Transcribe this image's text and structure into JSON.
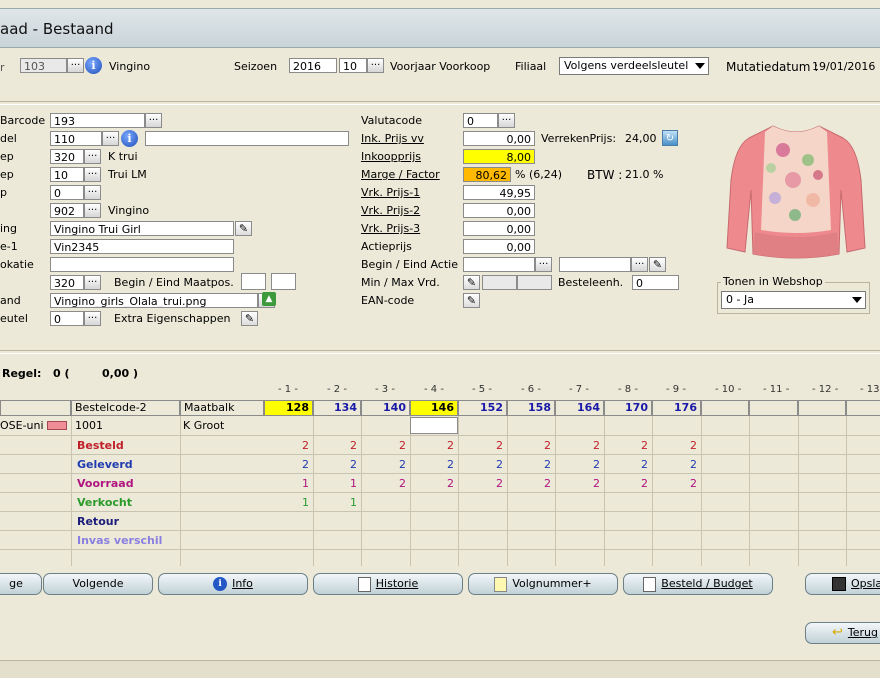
{
  "window": {
    "title": "aad - Bestaand"
  },
  "top": {
    "code_value": "103",
    "brand": "Vingino",
    "seizoen_label": "Seizoen",
    "seizoen_year": "2016",
    "seizoen_code": "10",
    "seizoen_name": "Voorjaar Voorkoop",
    "filiaal_label": "Filiaal",
    "filiaal_value": "Volgens verdeelsleutel",
    "mutatie_label": "Mutatiedatum :",
    "mutatie_value": "19/01/2016",
    "left_stub": "r"
  },
  "left": {
    "labels": [
      "Barcode",
      "del",
      "ep",
      "ep",
      "p",
      "",
      "ing",
      "e-1",
      "okatie",
      "",
      "and",
      "eutel"
    ],
    "barcode": "193",
    "artikel": "110",
    "groep1_code": "320",
    "groep1_name": "K trui",
    "groep2_code": "10",
    "groep2_name": "Trui LM",
    "f5": "0",
    "merk_code": "902",
    "merk_name": "Vingino",
    "omschrijving": "Vingino Trui Girl",
    "lev_code": "Vin2345",
    "locatie": "",
    "maat_code": "320",
    "maat_label": "Begin / Eind Maatpos.",
    "bestand": "Vingino_girls_Olala_trui.png",
    "sleutel": "0",
    "extra_label": "Extra Eigenschappen"
  },
  "mid": {
    "valutacode_label": "Valutacode",
    "valutacode": "0",
    "inkvv_label": "Ink. Prijs vv",
    "inkvv": "0,00",
    "verreken_label": "VerrekenPrijs:",
    "verreken": "24,00",
    "inkoop_label": "Inkoopprijs",
    "inkoop": "8,00",
    "marge_label": "Marge / Factor",
    "marge": "80,62",
    "factor": "% (6,24)",
    "btw_label": "BTW :",
    "btw": "21.0 %",
    "vrk1_label": "Vrk. Prijs-1",
    "vrk1": "49,95",
    "vrk2_label": "Vrk. Prijs-2",
    "vrk2": "0,00",
    "vrk3_label": "Vrk. Prijs-3",
    "vrk3": "0,00",
    "actie_label": "Actieprijs",
    "actie": "0,00",
    "beginactie_label": "Begin / Eind Actie",
    "minmax_label": "Min / Max Vrd.",
    "besteleenh_label": "Besteleenh.",
    "besteleenh": "0",
    "ean_label": "EAN-code"
  },
  "webshop": {
    "label": "Tonen in Webshop",
    "value": "0 - Ja"
  },
  "summary": {
    "regel_label": "Regel:",
    "regel_count": "0 (",
    "regel_amount": "0,00 )"
  },
  "grid": {
    "col_numbers": [
      "- 1 -",
      "- 2 -",
      "- 3 -",
      "- 4 -",
      "- 5 -",
      "- 6 -",
      "- 7 -",
      "- 8 -",
      "- 9 -",
      "- 10 -",
      "- 11 -",
      "- 12 -",
      "- 13"
    ],
    "h_bestelcode": "Bestelcode-2",
    "h_maatbalk": "Maatbalk",
    "sizes": [
      "128",
      "134",
      "140",
      "146",
      "152",
      "158",
      "164",
      "170",
      "176"
    ],
    "row0": {
      "kleur": "OSE-uni",
      "code": "1001",
      "maat": "K Groot"
    },
    "rows": [
      {
        "label": "Besteld",
        "color": "#c0202a",
        "values": [
          "2",
          "2",
          "2",
          "2",
          "2",
          "2",
          "2",
          "2",
          "2"
        ],
        "vcolor": "#c0202a"
      },
      {
        "label": "Geleverd",
        "color": "#1f3bb0",
        "values": [
          "2",
          "2",
          "2",
          "2",
          "2",
          "2",
          "2",
          "2",
          "2"
        ],
        "vcolor": "#1f3bb0"
      },
      {
        "label": "Voorraad",
        "color": "#b0157f",
        "values": [
          "1",
          "1",
          "2",
          "2",
          "2",
          "2",
          "2",
          "2",
          "2"
        ],
        "vcolor": "#b0157f"
      },
      {
        "label": "Verkocht",
        "color": "#2a9a2a",
        "values": [
          "1",
          "1",
          "",
          "",
          "",
          "",
          "",
          "",
          ""
        ],
        "vcolor": "#2a9a2a"
      },
      {
        "label": "Retour",
        "color": "#1c1c7a",
        "values": [
          "",
          "",
          "",
          "",
          "",
          "",
          "",
          "",
          ""
        ],
        "vcolor": "#1c1c7a"
      },
      {
        "label": "Invas verschil",
        "color": "#8a7fe0",
        "values": [
          "",
          "",
          "",
          "",
          "",
          "",
          "",
          "",
          ""
        ],
        "vcolor": "#8a7fe0"
      }
    ]
  },
  "buttons": {
    "vorige": "ge",
    "volgende": "Volgende",
    "info": "Info",
    "historie": "Historie",
    "volgnummer": "Volgnummer+",
    "besteld": "Besteld / Budget",
    "opslaan": "Opslaa",
    "terug": "Terug"
  },
  "colors": {
    "yellow": "#ffff00",
    "orange": "#ffb900",
    "swatch": "#f08c96"
  }
}
